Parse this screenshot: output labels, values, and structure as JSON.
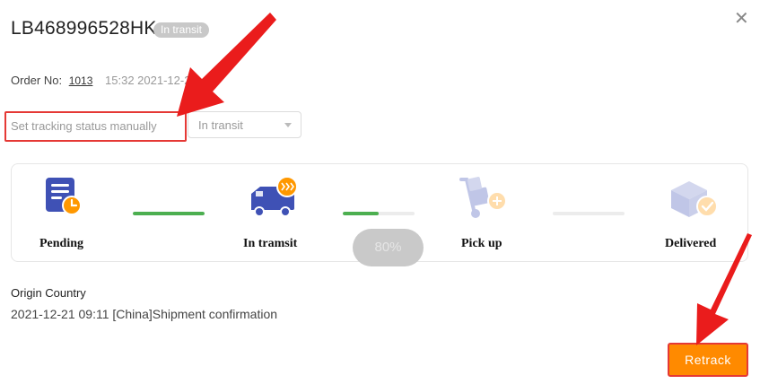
{
  "header": {
    "tracking_number": "LB468996528HK",
    "status_badge": "In transit"
  },
  "order": {
    "label": "Order No:",
    "number": "1013",
    "time": "15:32 2021-12-2"
  },
  "manual_status": {
    "label": "Set tracking status manually",
    "selected": "In transit"
  },
  "progress": {
    "steps": [
      {
        "label": "Pending",
        "icon": "pending-document-clock-icon"
      },
      {
        "label": "In tramsit",
        "icon": "delivery-truck-icon"
      },
      {
        "label": "Pick up",
        "icon": "pickup-hand-truck-icon"
      },
      {
        "label": "Delivered",
        "icon": "delivered-box-check-icon"
      }
    ],
    "connectors": [
      1.0,
      0.5,
      0.0
    ],
    "percent_text": "80%"
  },
  "origin": {
    "title": "Origin Country",
    "event": "2021-12-21 09:11 [China]Shipment confirmation"
  },
  "actions": {
    "retrack_label": "Retrack"
  },
  "colors": {
    "accent_orange": "#ff8a00",
    "progress_green": "#4caf50",
    "icon_blue": "#3f51b5",
    "highlight_red": "#e53935"
  }
}
